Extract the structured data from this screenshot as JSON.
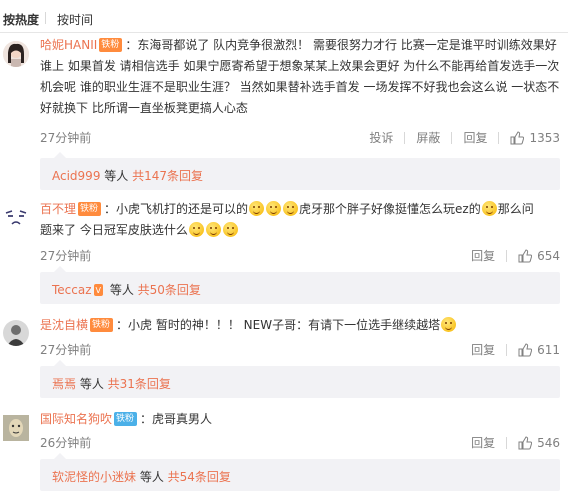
{
  "sort": {
    "hot": "按热度",
    "time": "按时间"
  },
  "comments": [
    {
      "user": "哈妮HANII",
      "badge": "铁粉",
      "badge_color": "#ff8b3d",
      "lines": [
        "：东海哥都说了 队内竞争很激烈！ 需要很努力才行 比赛一定是谁平时训练效果好",
        "谁上 如果首发 请相信选手 如果宁愿寄希望于想象某某上效果会更好 为什么不能再给首发选手一次",
        "机会呢 谁的职业生涯不是职业生涯？ 当然如果替补选手首发 一场发挥不好我也会这么说 一状态不",
        "好就换下 比所谓一直坐板凳更搞人心态"
      ],
      "time": "27分钟前",
      "report": "投诉",
      "block": "屏蔽",
      "reply": "回复",
      "likes": "1353",
      "reply_user": "Acid999",
      "reply_mid": " 等人 ",
      "reply_link": "共147条回复"
    },
    {
      "user": "百不理",
      "badge": "铁粉",
      "badge_color": "#ff8b3d",
      "line1_a": "：小虎飞机打的还是可以的",
      "line1_b": "虎牙那个胖子好像挺懂怎么玩ez的",
      "line1_c": "那么问",
      "line2_a": "题来了 今日冠军皮肤选什么",
      "time": "27分钟前",
      "reply": "回复",
      "likes": "654",
      "reply_user": "Teccaz",
      "reply_mid": " 等人 ",
      "reply_link": "共50条回复"
    },
    {
      "user": "是沈自横",
      "badge": "铁粉",
      "badge_color": "#ff8b3d",
      "text": "：小虎   暂时的神！！！    NEW子哥：有请下一位选手继续越塔",
      "time": "27分钟前",
      "reply": "回复",
      "likes": "611",
      "reply_user": "焉焉",
      "reply_mid": " 等人 ",
      "reply_link": "共31条回复"
    },
    {
      "user": "国际知名狗吹",
      "badge": "铁粉",
      "badge_color": "#4bb0e8",
      "text": "：虎哥真男人",
      "time": "26分钟前",
      "reply": "回复",
      "likes": "546",
      "reply_user": "软泥怪的小迷妹",
      "reply_mid": " 等人 ",
      "reply_link": "共54条回复"
    }
  ]
}
